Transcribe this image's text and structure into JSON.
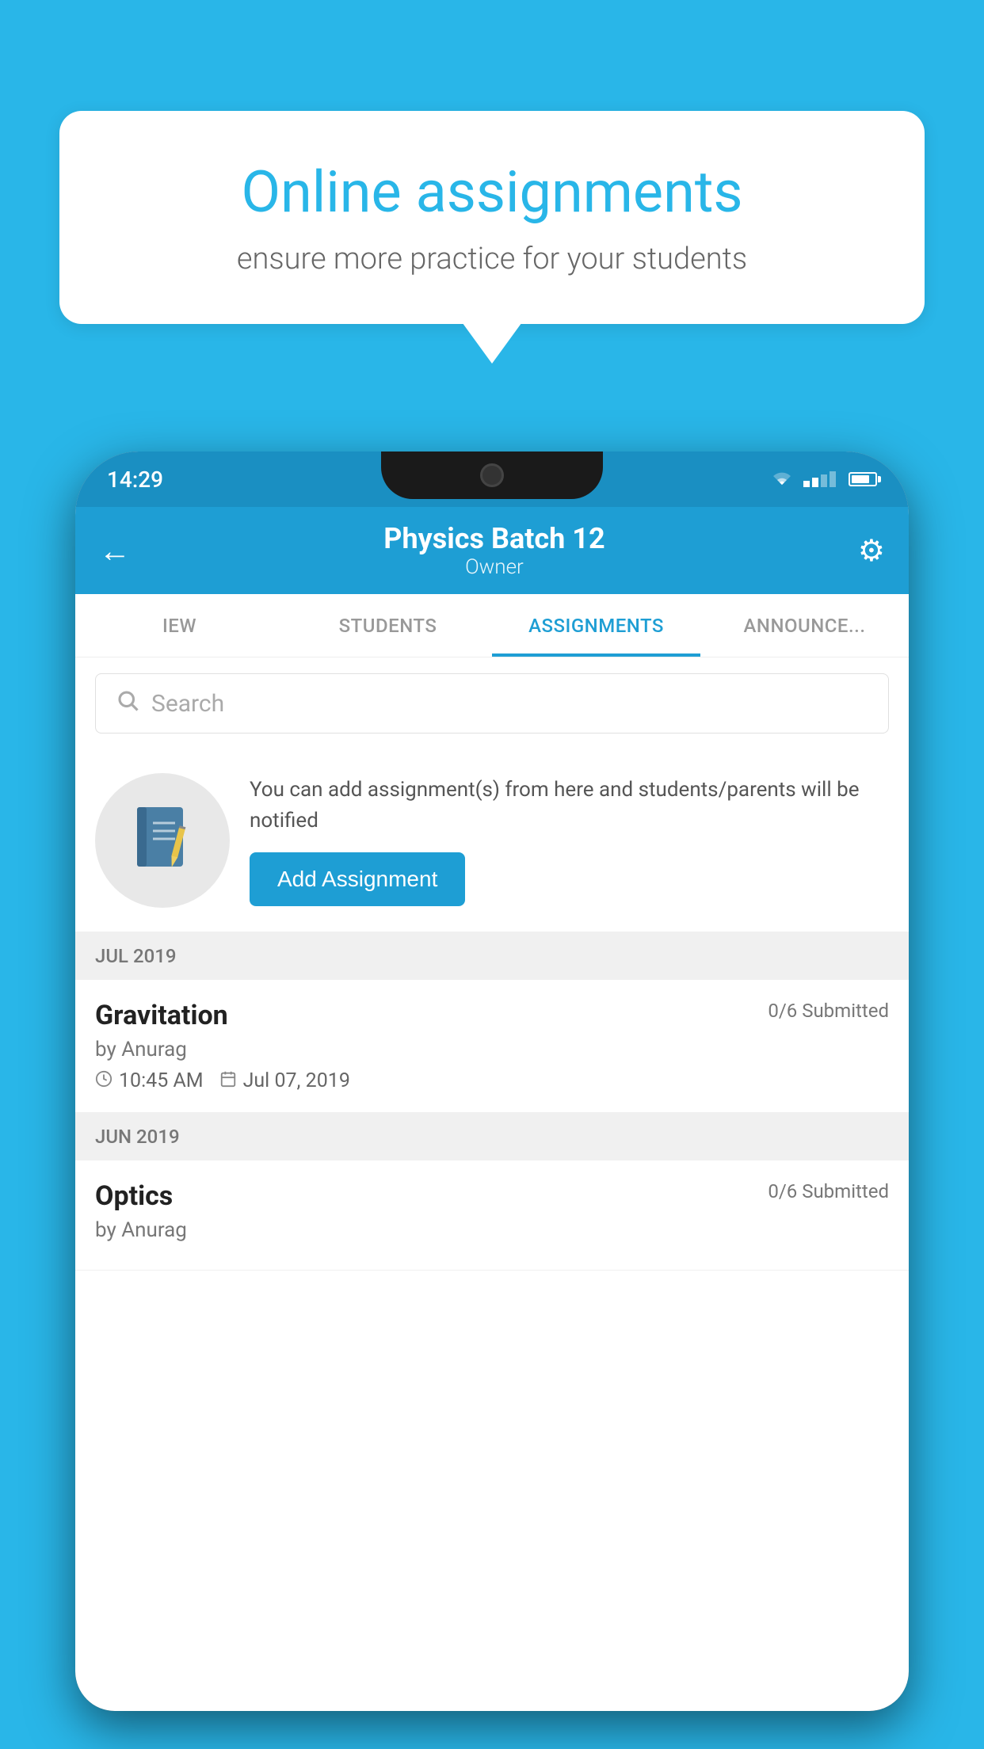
{
  "background_color": "#29b6e8",
  "speech_bubble": {
    "title": "Online assignments",
    "subtitle": "ensure more practice for your students"
  },
  "phone": {
    "status_bar": {
      "time": "14:29"
    },
    "header": {
      "title": "Physics Batch 12",
      "subtitle": "Owner",
      "back_label": "←",
      "settings_label": "⚙"
    },
    "tabs": [
      {
        "label": "IEW",
        "active": false
      },
      {
        "label": "STUDENTS",
        "active": false
      },
      {
        "label": "ASSIGNMENTS",
        "active": true
      },
      {
        "label": "ANNOUNCE...",
        "active": false
      }
    ],
    "search": {
      "placeholder": "Search"
    },
    "promo": {
      "text": "You can add assignment(s) from here and students/parents will be notified",
      "button_label": "Add Assignment"
    },
    "sections": [
      {
        "header": "JUL 2019",
        "assignments": [
          {
            "title": "Gravitation",
            "submitted": "0/6 Submitted",
            "author": "by Anurag",
            "time": "10:45 AM",
            "date": "Jul 07, 2019"
          }
        ]
      },
      {
        "header": "JUN 2019",
        "assignments": [
          {
            "title": "Optics",
            "submitted": "0/6 Submitted",
            "author": "by Anurag",
            "time": "",
            "date": ""
          }
        ]
      }
    ]
  }
}
